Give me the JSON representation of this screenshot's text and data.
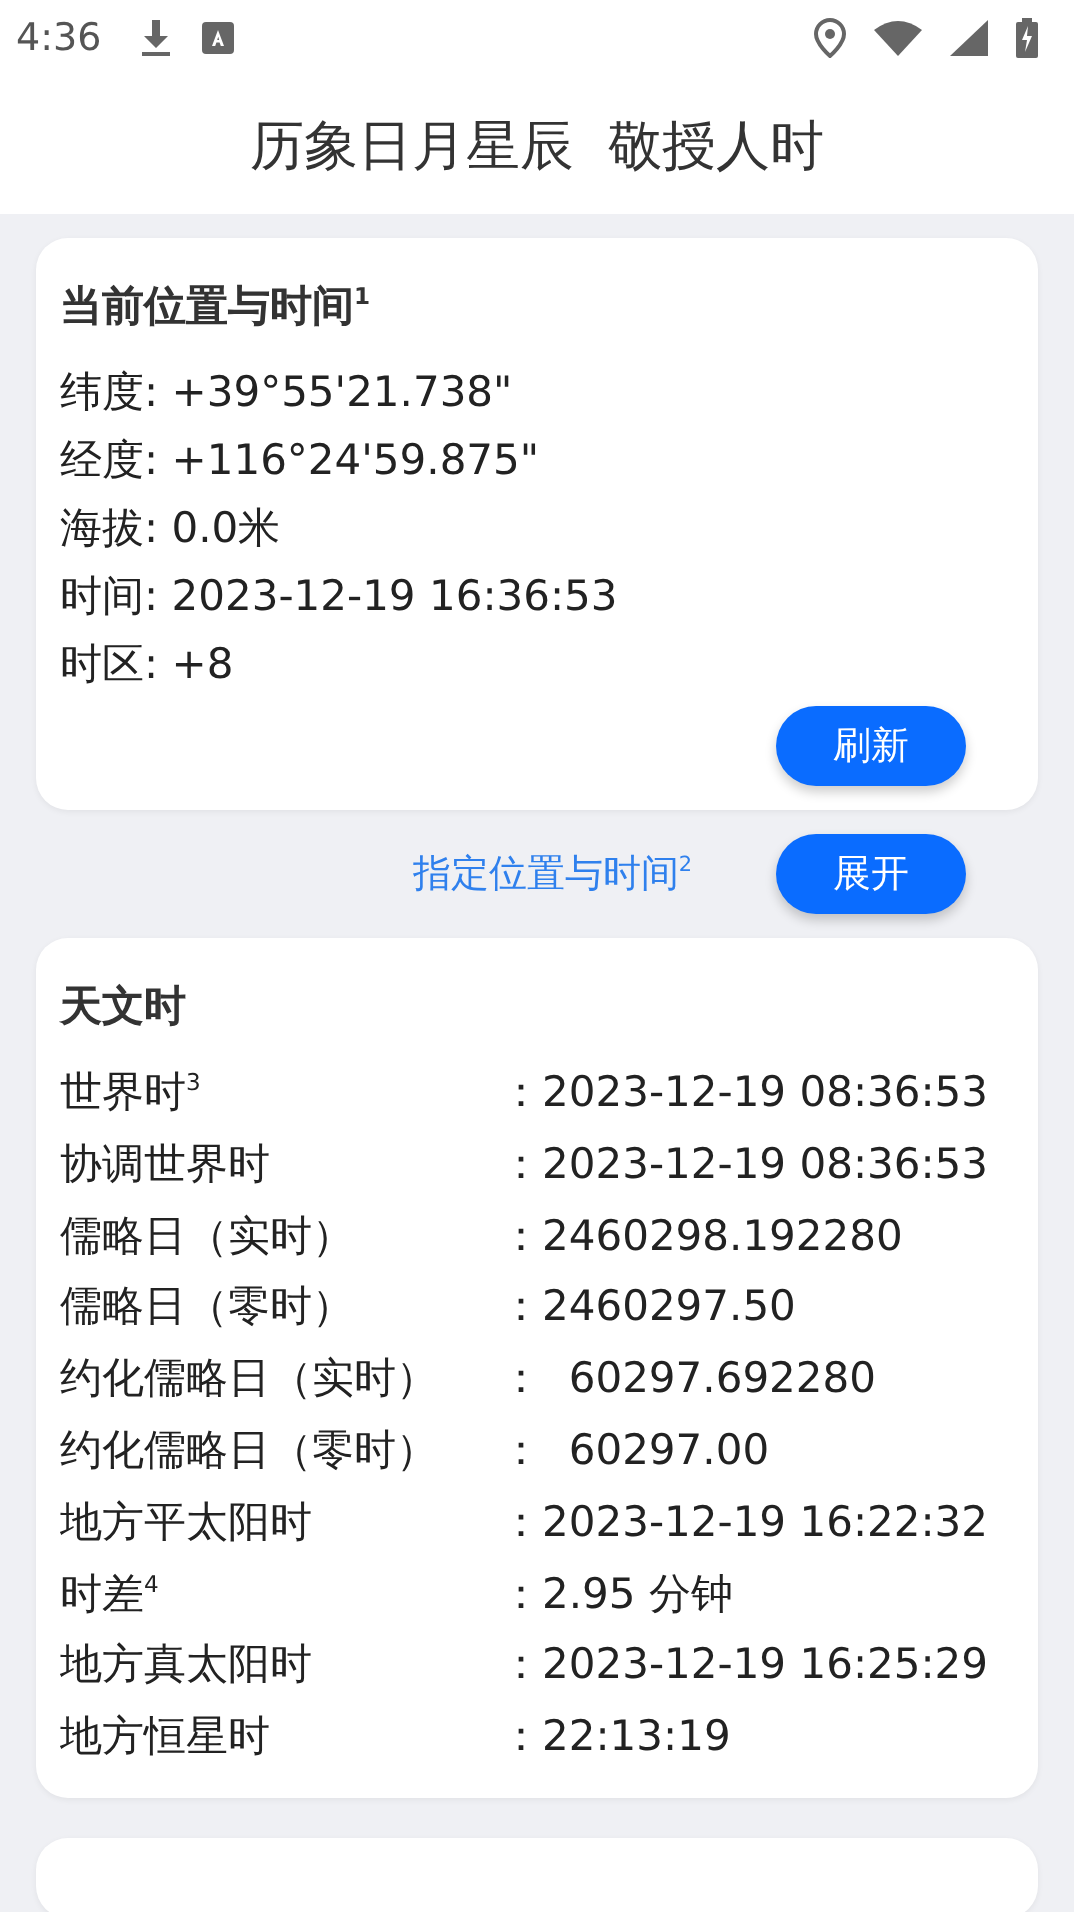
{
  "status_bar": {
    "time": "4:36"
  },
  "app_bar": {
    "title": "历象日月星辰  敬授人时"
  },
  "current": {
    "title": "当前位置与时间$^{1}$",
    "lines": [
      "纬度: +39°55'21.738\"",
      "经度: +116°24'59.875\"",
      "海拔: 0.0米",
      "时间: 2023-12-19 16:36:53",
      "时区: +8"
    ],
    "button": "刷新"
  },
  "specify": {
    "link": "指定位置与时间$^{2}$",
    "button": "展开"
  },
  "astro": {
    "title": "天文时",
    "rows": [
      {
        "label": "世界时$^{3}$",
        "value": "：2023-12-19 08:36:53"
      },
      {
        "label": "协调世界时",
        "value": "：2023-12-19 08:36:53"
      },
      {
        "label": "儒略日（实时）",
        "value": "：2460298.192280"
      },
      {
        "label": "儒略日（零时）",
        "value": "：2460297.50"
      },
      {
        "label": "约化儒略日（实时）",
        "value": "：  60297.692280"
      },
      {
        "label": "约化儒略日（零时）",
        "value": "：  60297.00"
      },
      {
        "label": "地方平太阳时",
        "value": "：2023-12-19 16:22:32"
      },
      {
        "label": "时差$^{4}$",
        "value": "：2.95 分钟"
      },
      {
        "label": "地方真太阳时",
        "value": "：2023-12-19 16:25:29"
      },
      {
        "label": "地方恒星时",
        "value": "：22:13:19"
      }
    ]
  }
}
